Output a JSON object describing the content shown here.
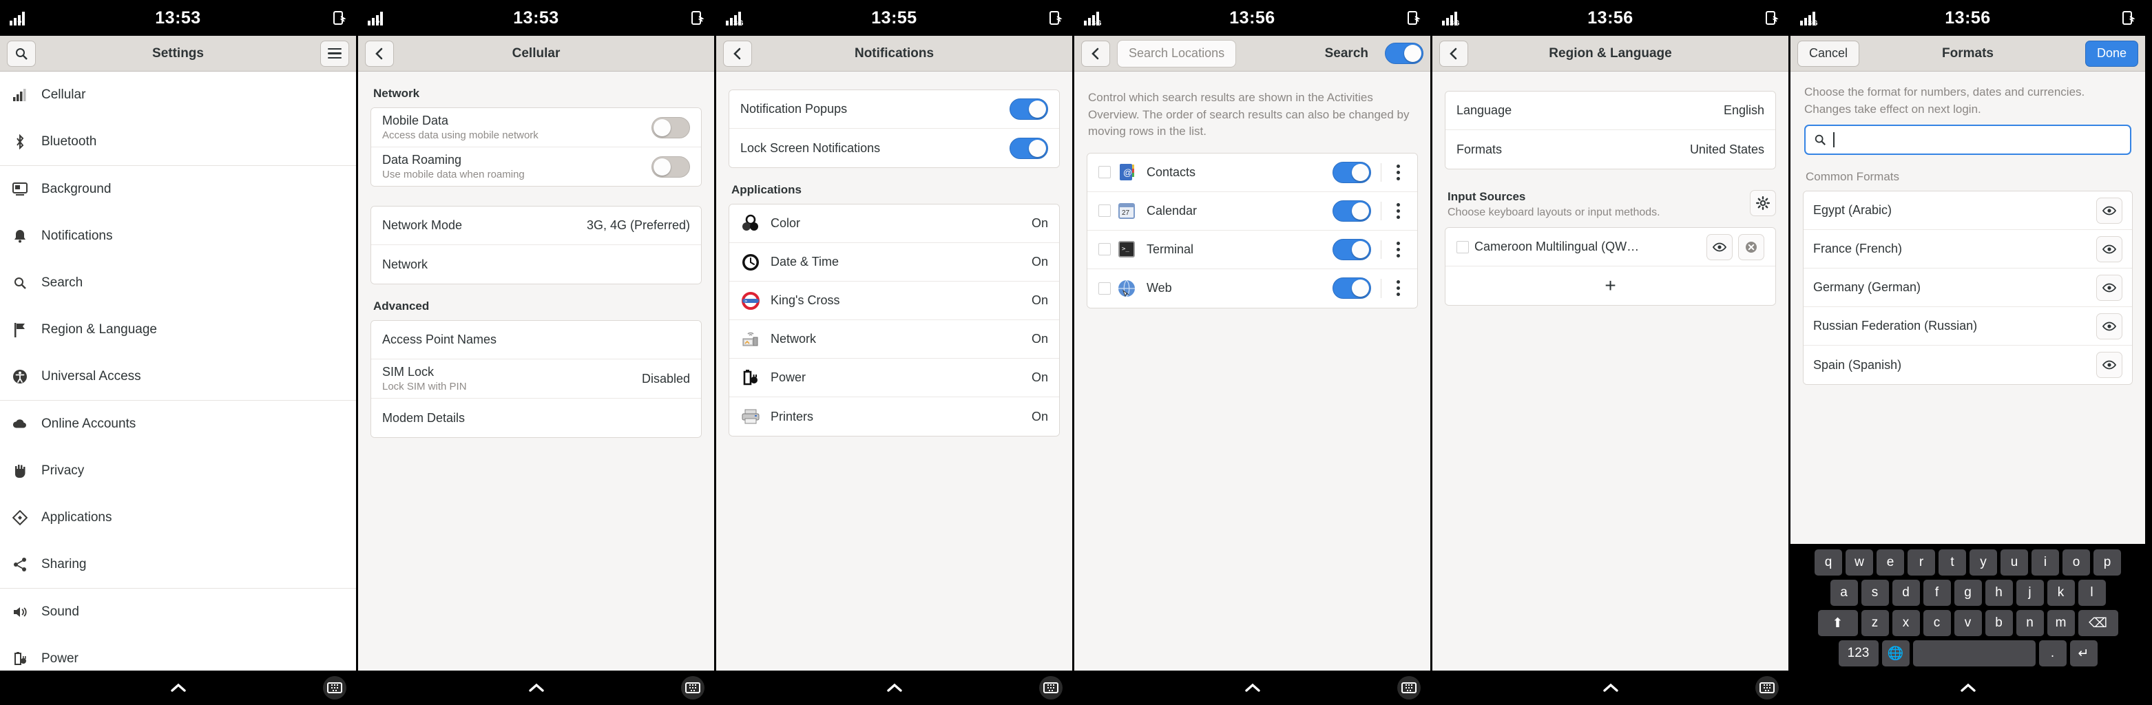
{
  "panels": [
    {
      "id": "settings-main",
      "status": {
        "time": "13:53"
      },
      "header": {
        "title": "Settings",
        "search_icon": "search-icon",
        "menu_icon": "hamburger-icon"
      },
      "sidebar": {
        "items": [
          {
            "label": "Cellular",
            "icon": "cellular-signal-icon"
          },
          {
            "label": "Bluetooth",
            "icon": "bluetooth-icon"
          },
          {
            "label": "Background",
            "icon": "monitor-wallpaper-icon"
          },
          {
            "label": "Notifications",
            "icon": "bell-icon"
          },
          {
            "label": "Search",
            "icon": "search-icon"
          },
          {
            "label": "Region & Language",
            "icon": "flag-icon"
          },
          {
            "label": "Universal Access",
            "icon": "accessibility-icon"
          },
          {
            "label": "Online Accounts",
            "icon": "cloud-icon"
          },
          {
            "label": "Privacy",
            "icon": "hand-icon"
          },
          {
            "label": "Applications",
            "icon": "apps-diamond-icon"
          },
          {
            "label": "Sharing",
            "icon": "share-nodes-icon"
          },
          {
            "label": "Sound",
            "icon": "speaker-icon"
          },
          {
            "label": "Power",
            "icon": "battery-plug-icon"
          }
        ],
        "separators_after": [
          1,
          10
        ]
      }
    },
    {
      "id": "cellular",
      "status": {
        "time": "13:53"
      },
      "header": {
        "title": "Cellular",
        "back_icon": "chevron-left-icon"
      },
      "groups": [
        {
          "title": "Network",
          "cards": [
            {
              "rows": [
                {
                  "title": "Mobile Data",
                  "sub": "Access data using mobile network",
                  "toggle": "off"
                },
                {
                  "title": "Data Roaming",
                  "sub": "Use mobile data when roaming",
                  "toggle": "off"
                }
              ]
            },
            {
              "rows": [
                {
                  "title": "Network Mode",
                  "value": "3G, 4G (Preferred)"
                },
                {
                  "title": "Network"
                }
              ]
            }
          ]
        },
        {
          "title": "Advanced",
          "cards": [
            {
              "rows": [
                {
                  "title": "Access Point Names"
                },
                {
                  "title": "SIM Lock",
                  "sub": "Lock SIM with PIN",
                  "value": "Disabled"
                },
                {
                  "title": "Modem Details"
                }
              ]
            }
          ]
        }
      ]
    },
    {
      "id": "notifications",
      "status": {
        "time": "13:55"
      },
      "header": {
        "title": "Notifications",
        "back_icon": "chevron-left-icon"
      },
      "top_card": {
        "rows": [
          {
            "title": "Notification Popups",
            "toggle": "on"
          },
          {
            "title": "Lock Screen Notifications",
            "toggle": "on"
          }
        ]
      },
      "applications_title": "Applications",
      "applications": [
        {
          "label": "Color",
          "state": "On",
          "icon": "color-circles-icon"
        },
        {
          "label": "Date & Time",
          "state": "On",
          "icon": "clock-icon"
        },
        {
          "label": "King's Cross",
          "state": "On",
          "icon": "kings-cross-terminal-icon"
        },
        {
          "label": "Network",
          "state": "On",
          "icon": "network-device-icon"
        },
        {
          "label": "Power",
          "state": "On",
          "icon": "battery-plug-icon"
        },
        {
          "label": "Printers",
          "state": "On",
          "icon": "printer-icon"
        }
      ]
    },
    {
      "id": "search",
      "status": {
        "time": "13:56"
      },
      "header": {
        "title": "Search",
        "back_icon": "chevron-left-icon",
        "locations_button": "Search Locations",
        "master_toggle": "on"
      },
      "description": "Control which search results are shown in the Activities Overview. The order of search results can also be changed by moving rows in the list.",
      "results": [
        {
          "label": "Contacts",
          "toggle": "on",
          "icon": "contacts-book-icon"
        },
        {
          "label": "Calendar",
          "toggle": "on",
          "icon": "calendar-27-icon"
        },
        {
          "label": "Terminal",
          "toggle": "on",
          "icon": "terminal-icon"
        },
        {
          "label": "Web",
          "toggle": "on",
          "icon": "web-globe-icon"
        }
      ]
    },
    {
      "id": "region-language",
      "status": {
        "time": "13:56"
      },
      "header": {
        "title": "Region & Language",
        "back_icon": "chevron-left-icon"
      },
      "card_rows": [
        {
          "title": "Language",
          "value": "English"
        },
        {
          "title": "Formats",
          "value": "United States"
        }
      ],
      "input_sources": {
        "title": "Input Sources",
        "subtitle": "Choose keyboard layouts or input methods.",
        "gear_icon": "gear-icon",
        "items": [
          {
            "label": "Cameroon Multilingual (QW…",
            "preview_icon": "eye-icon",
            "remove_icon": "remove-circle-icon"
          }
        ],
        "add_label": "+"
      }
    },
    {
      "id": "formats-dialog",
      "status": {
        "time": "13:56"
      },
      "header": {
        "title": "Formats",
        "cancel_label": "Cancel",
        "done_label": "Done"
      },
      "description": "Choose the format for numbers, dates and currencies. Changes take effect on next login.",
      "search": {
        "placeholder": "",
        "value": "",
        "icon": "search-icon"
      },
      "list_title": "Common Formats",
      "formats": [
        {
          "label": "Egypt (Arabic)",
          "preview_icon": "eye-icon"
        },
        {
          "label": "France (French)",
          "preview_icon": "eye-icon"
        },
        {
          "label": "Germany (German)",
          "preview_icon": "eye-icon"
        },
        {
          "label": "Russian Federation (Russian)",
          "preview_icon": "eye-icon"
        },
        {
          "label": "Spain (Spanish)",
          "preview_icon": "eye-icon"
        }
      ],
      "keyboard": {
        "row1": [
          "q",
          "w",
          "e",
          "r",
          "t",
          "y",
          "u",
          "i",
          "o",
          "p"
        ],
        "row2": [
          "a",
          "s",
          "d",
          "f",
          "g",
          "h",
          "j",
          "k",
          "l"
        ],
        "row3_shift": "⬆",
        "row3": [
          "z",
          "x",
          "c",
          "v",
          "b",
          "n",
          "m"
        ],
        "row3_backspace": "⌫",
        "row4_numbers": "123",
        "row4_globe": "🌐",
        "row4_space": "",
        "row4_period": ".",
        "row4_enter": "↵"
      }
    }
  ],
  "navbar": {
    "home_icon": "chevron-up-icon",
    "keyboard_icon": "keyboard-icon"
  },
  "colors": {
    "accent": "#3584e4",
    "headerbar": "#dfdcd8",
    "page_bg": "#f6f5f4",
    "toggle_off": "#cfcac5"
  }
}
